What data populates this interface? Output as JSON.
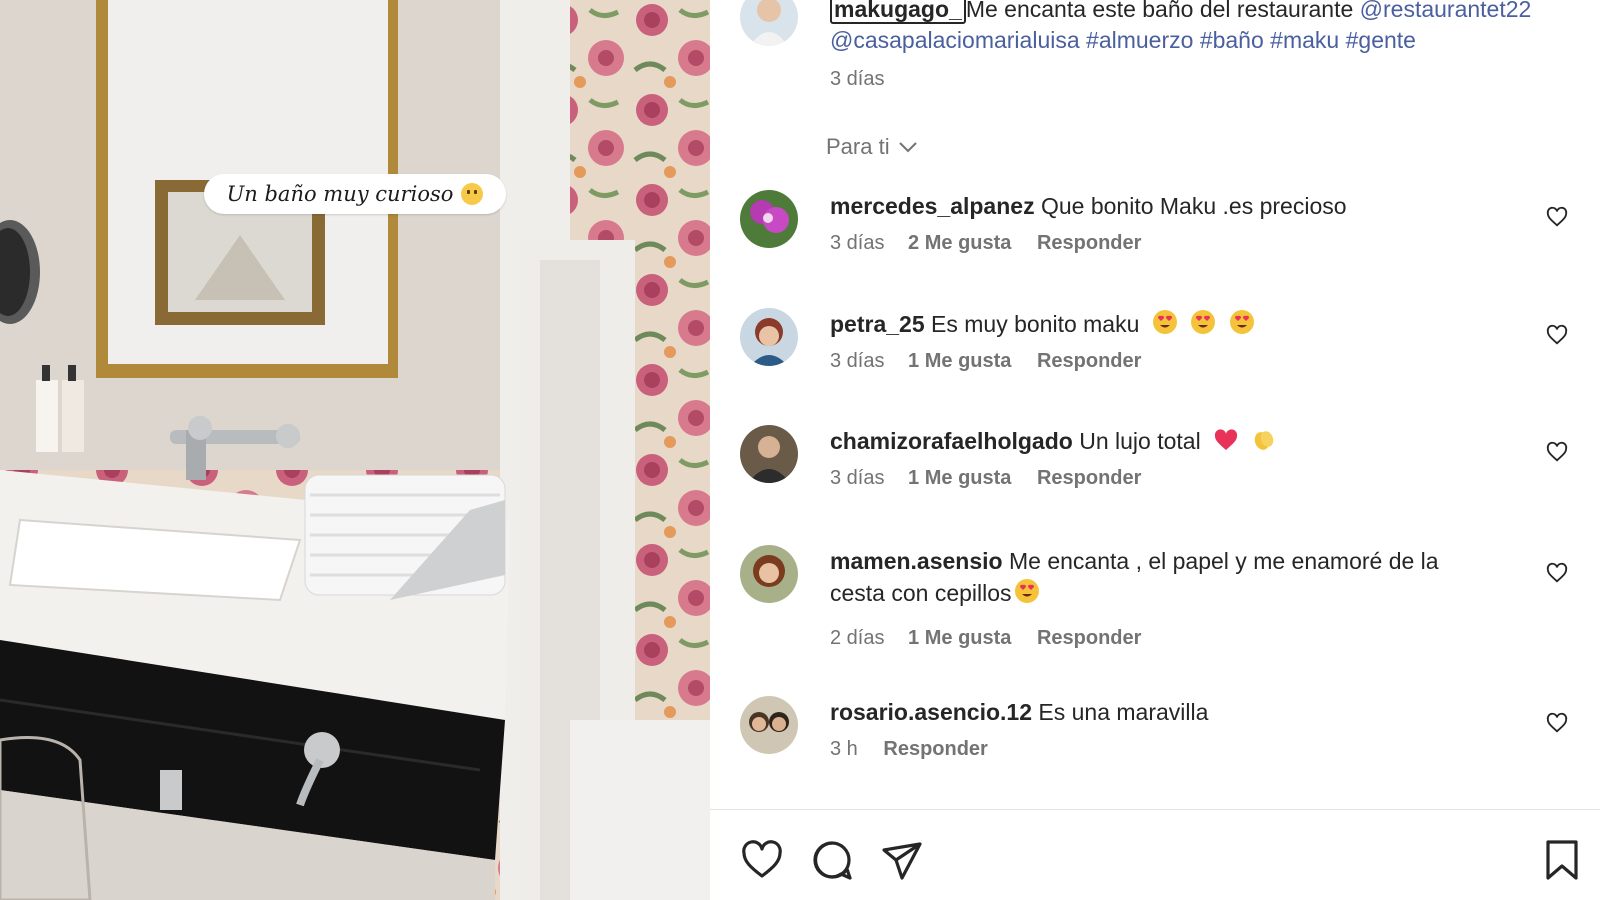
{
  "photo": {
    "caption_text": "Un baño muy curioso",
    "caption_emoji": "face-with-raised-eyebrow"
  },
  "post": {
    "username": "makugago_",
    "text": "Me encanta este baño del restaurante",
    "mentions": [
      "@restaurantet22",
      "@casapalaciomarialuisa"
    ],
    "hashtags": [
      "#almuerzo",
      "#baño",
      "#maku",
      "#gente"
    ],
    "time": "3 días"
  },
  "sort": {
    "label": "Para ti"
  },
  "comments": [
    {
      "username": "mercedes_alpanez",
      "text": "Que bonito Maku .es precioso",
      "time": "3 días",
      "likes": "2 Me gusta",
      "reply": "Responder"
    },
    {
      "username": "petra_25",
      "text": "Es muy bonito maku",
      "emojis": [
        "heart-eyes",
        "heart-eyes",
        "heart-eyes"
      ],
      "time": "3 días",
      "likes": "1 Me gusta",
      "reply": "Responder"
    },
    {
      "username": "chamizorafaelholgado",
      "text": "Un lujo total",
      "emojis": [
        "red-heart",
        "clapping-hands"
      ],
      "time": "3 días",
      "likes": "1 Me gusta",
      "reply": "Responder"
    },
    {
      "username": "mamen.asensio",
      "text": "Me encanta , el papel y me enamoré de la",
      "text2": "cesta con cepillos",
      "emojis": [
        "heart-eyes"
      ],
      "time": "2 días",
      "likes": "1 Me gusta",
      "reply": "Responder"
    },
    {
      "username": "rosario.asencio.12",
      "text": "Es una maravilla",
      "time": "3 h",
      "reply": "Responder"
    }
  ],
  "actions": [
    "heart-icon",
    "comment-icon",
    "share-icon",
    "bookmark-icon"
  ],
  "colors": {
    "link": "#4a5f9f",
    "muted": "#737373",
    "text": "#262626"
  }
}
